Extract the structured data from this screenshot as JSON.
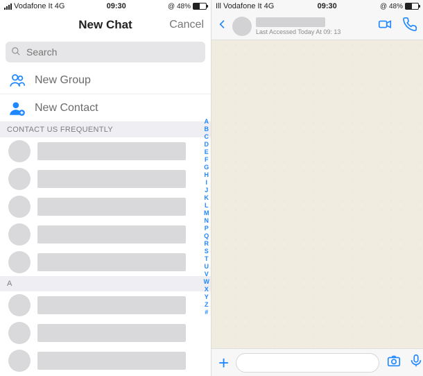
{
  "left": {
    "status": {
      "carrier": "Vodafone It 4G",
      "time": "09:30",
      "battery": "@ 48%",
      "sig_prefix": "Ill"
    },
    "nav": {
      "title": "New Chat",
      "cancel": "Cancel"
    },
    "search": {
      "placeholder": "Search"
    },
    "rows": {
      "new_group": "New Group",
      "new_contact": "New Contact"
    },
    "section_frequent": "CONTACT US FREQUENTLY",
    "section_a": "A",
    "index": [
      "A",
      "B",
      "C",
      "D",
      "E",
      "F",
      "G",
      "H",
      "I",
      "J",
      "K",
      "L",
      "M",
      "N",
      "",
      "P",
      "Q",
      "R",
      "S",
      "T",
      "U",
      "V",
      "W",
      "X",
      "Y",
      "Z",
      "#"
    ]
  },
  "right": {
    "status": {
      "carrier": "Vodafone It 4G",
      "time": "09:30",
      "battery": "@ 48%",
      "sig_prefix": "Ill"
    },
    "header": {
      "last_access": "Last Accessed Today At 09: 13"
    },
    "input": {
      "placeholder": ""
    }
  },
  "colors": {
    "accent": "#1f87ff"
  }
}
